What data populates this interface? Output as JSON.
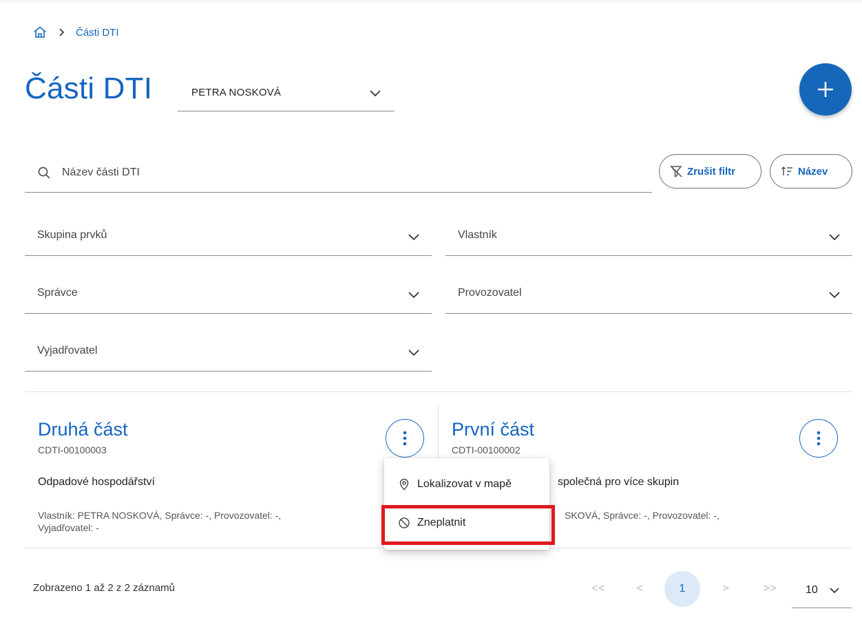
{
  "breadcrumb": {
    "home_icon": "home-icon",
    "current": "Části DTI"
  },
  "page": {
    "title": "Části DTI"
  },
  "owner_select": {
    "value": "PETRA NOSKOVÁ"
  },
  "add_button": {
    "icon": "plus-icon",
    "color": "#1667b9"
  },
  "search": {
    "placeholder": "Název části DTI",
    "value": ""
  },
  "actions": {
    "clear_filter": "Zrušit filtr",
    "sort": "Název"
  },
  "filters": {
    "group": "Skupina prvků",
    "owner": "Vlastník",
    "administrator": "Správce",
    "operator": "Provozovatel",
    "commenter": "Vyjadřovatel"
  },
  "cards": [
    {
      "title": "Druhá část",
      "code": "CDTI-00100003",
      "group": "Odpadové hospodářství",
      "meta_line1": "Vlastník: PETRA NOSKOVÁ, Správce: -, Provozovatel: -,",
      "meta_line2": "Vyjadřovatel: -"
    },
    {
      "title": "První část",
      "code": "CDTI-00100002",
      "group": "společná pro více skupin",
      "meta_line1": "SKOVÁ, Správce: -, Provozovatel: -,"
    }
  ],
  "menu": {
    "items": [
      {
        "label": "Lokalizovat v mapě",
        "icon": "map-pin-icon"
      },
      {
        "label": "Zneplatnit",
        "icon": "block-icon"
      }
    ],
    "highlight_color": "#e0191e"
  },
  "footer": {
    "count_text": "Zobrazeno 1 až 2 z 2 záznamů",
    "pager": {
      "first": "<<",
      "prev": "<",
      "current": "1",
      "next": ">",
      "last": ">>"
    },
    "page_size": "10"
  },
  "colors": {
    "primary": "#1565c0",
    "active_page_bg": "#dce9f7"
  }
}
